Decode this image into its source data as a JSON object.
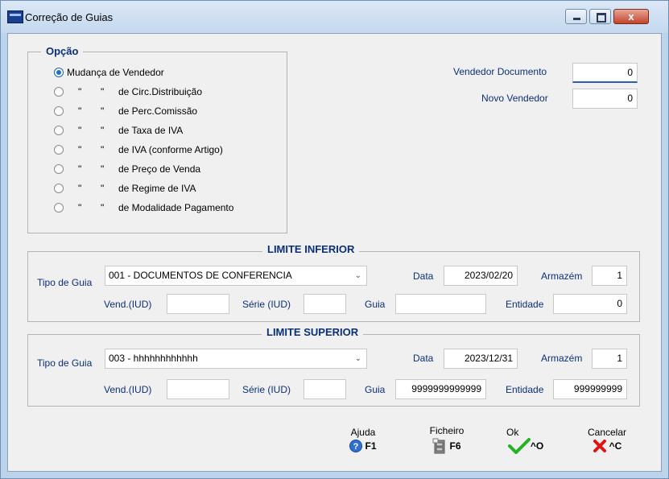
{
  "window": {
    "title": "Correção de Guias",
    "close_glyph": "x"
  },
  "opcao": {
    "legend": "Opção",
    "options": [
      {
        "q1": "",
        "q2": "",
        "label": "Mudança de Vendedor",
        "selected": true
      },
      {
        "q1": "\"",
        "q2": "\"",
        "label": "de Circ.Distribuição",
        "selected": false
      },
      {
        "q1": "\"",
        "q2": "\"",
        "label": "de Perc.Comissão",
        "selected": false
      },
      {
        "q1": "\"",
        "q2": "\"",
        "label": "de Taxa de IVA",
        "selected": false
      },
      {
        "q1": "\"",
        "q2": "\"",
        "label": "de IVA  (conforme Artigo)",
        "selected": false
      },
      {
        "q1": "\"",
        "q2": "\"",
        "label": "de Preço de Venda",
        "selected": false
      },
      {
        "q1": "\"",
        "q2": "\"",
        "label": "de Regime de IVA",
        "selected": false
      },
      {
        "q1": "\"",
        "q2": "\"",
        "label": "de Modalidade Pagamento",
        "selected": false
      }
    ]
  },
  "vendedor": {
    "documento_label": "Vendedor Documento",
    "documento_value": "0",
    "novo_label": "Novo Vendedor",
    "novo_value": "0"
  },
  "limite_inferior": {
    "title": "LIMITE INFERIOR",
    "tipo_label": "Tipo de Guia",
    "tipo_value": "001 - DOCUMENTOS DE CONFERENCIA",
    "data_label": "Data",
    "data_value": "2023/02/20",
    "armazem_label": "Armazém",
    "armazem_value": "1",
    "vend_label": "Vend.(IUD)",
    "vend_value": "",
    "serie_label": "Série (IUD)",
    "serie_value": "",
    "guia_label": "Guia",
    "guia_value": "",
    "entidade_label": "Entidade",
    "entidade_value": "0"
  },
  "limite_superior": {
    "title": "LIMITE SUPERIOR",
    "tipo_label": "Tipo de Guia",
    "tipo_value": "003 - hhhhhhhhhhhh",
    "data_label": "Data",
    "data_value": "2023/12/31",
    "armazem_label": "Armazém",
    "armazem_value": "1",
    "vend_label": "Vend.(IUD)",
    "vend_value": "",
    "serie_label": "Série (IUD)",
    "serie_value": "",
    "guia_label": "Guia",
    "guia_value": "9999999999999",
    "entidade_label": "Entidade",
    "entidade_value": "999999999"
  },
  "toolbar": {
    "ajuda_label": "Ajuda",
    "ajuda_key": "F1",
    "ajuda_icon": "help-icon",
    "ficheiro_label": "Ficheiro",
    "ficheiro_key": "F6",
    "ficheiro_icon": "file-cabinet-icon",
    "ok_label": "Ok",
    "ok_key": "^O",
    "ok_icon": "checkmark-icon",
    "cancelar_label": "Cancelar",
    "cancelar_key": "^C",
    "cancelar_icon": "cross-icon"
  },
  "colors": {
    "label_blue": "#0b2f7a",
    "ok_green": "#22b322",
    "cancel_red": "#e01414",
    "help_blue": "#2f6fd0"
  }
}
